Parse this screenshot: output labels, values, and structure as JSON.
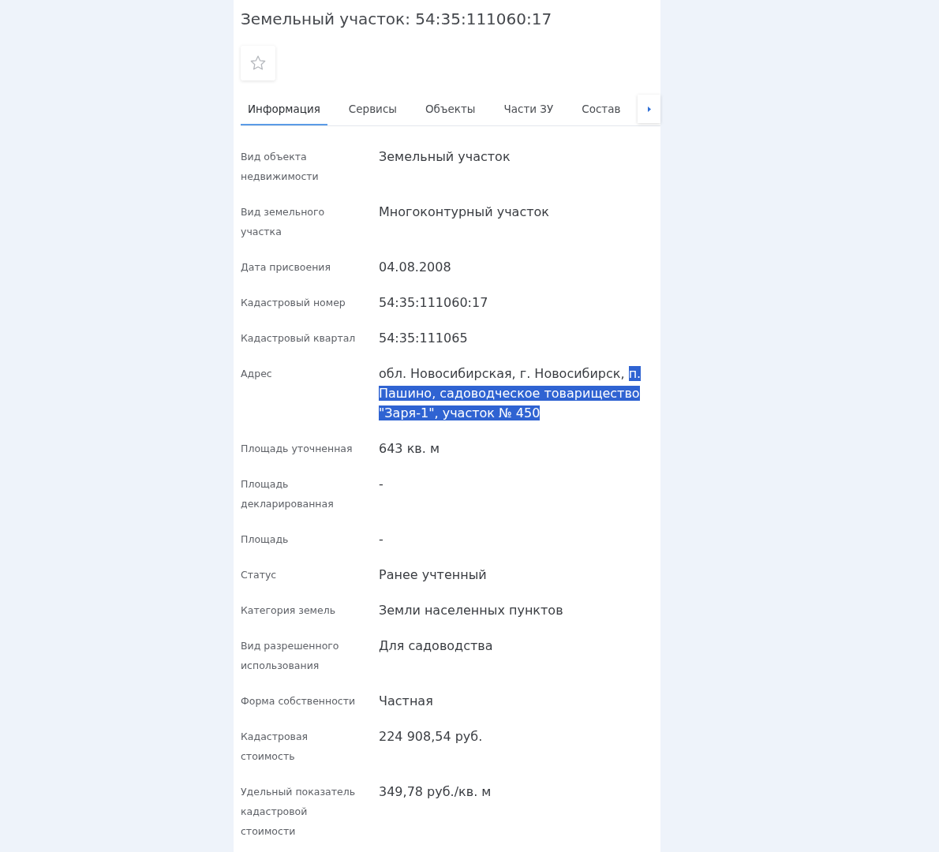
{
  "title": "Земельный участок: 54:35:111060:17",
  "favorite": {
    "starred": false
  },
  "tabs": [
    {
      "label": "Информация",
      "selected": true
    },
    {
      "label": "Сервисы",
      "selected": false
    },
    {
      "label": "Объекты",
      "selected": false
    },
    {
      "label": "Части ЗУ",
      "selected": false
    },
    {
      "label": "Состав",
      "selected": false
    }
  ],
  "rows": [
    {
      "label": "Вид объекта недвижимости",
      "value": "Земельный участок"
    },
    {
      "label": "Вид земельного участка",
      "value": "Многоконтурный участок"
    },
    {
      "label": "Дата присвоения",
      "value": "04.08.2008"
    },
    {
      "label": "Кадастровый номер",
      "value": "54:35:111060:17"
    },
    {
      "label": "Кадастровый квартал",
      "value": "54:35:111065"
    },
    {
      "label": "Адрес",
      "value_parts": [
        {
          "text": "обл. Новосибирская, г. Новосибирск, ",
          "selected": false
        },
        {
          "text": "п. Пашино, садоводческое товарищество \"Заря-1\", участок № 450",
          "selected": true
        }
      ]
    },
    {
      "label": "Площадь уточненная",
      "value": "643 кв. м"
    },
    {
      "label": "Площадь декларированная",
      "value": "-"
    },
    {
      "label": "Площадь",
      "value": "-"
    },
    {
      "label": "Статус",
      "value": "Ранее учтенный"
    },
    {
      "label": "Категория земель",
      "value": "Земли населенных пунктов"
    },
    {
      "label": "Вид разрешенного использования",
      "value": "Для садоводства"
    },
    {
      "label": "Форма собственности",
      "value": "Частная"
    },
    {
      "label": "Кадастровая стоимость",
      "value": "224 908,54 руб."
    },
    {
      "label": "Удельный показатель кадастровой стоимости",
      "value": "349,78 руб./кв. м"
    }
  ]
}
